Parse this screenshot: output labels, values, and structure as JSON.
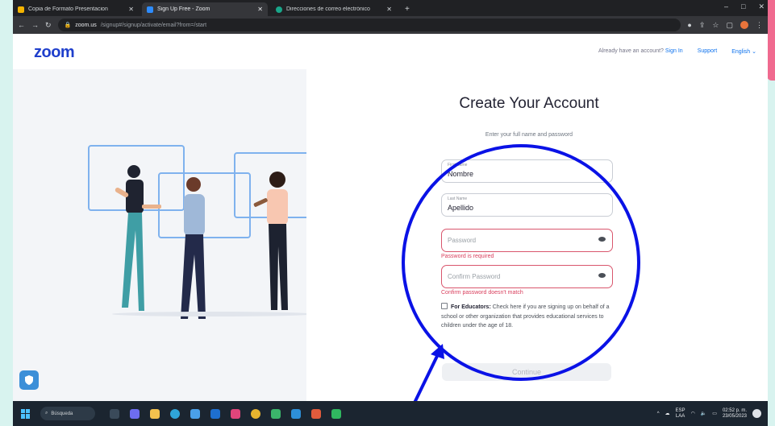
{
  "browser": {
    "tabs": [
      {
        "title": "Copia de Formato Presentacion",
        "favicon_color": "#f4b400",
        "active": false
      },
      {
        "title": "Sign Up Free - Zoom",
        "favicon_color": "#2d8cff",
        "active": true
      },
      {
        "title": "Direcciones de correo electrónico",
        "favicon_color": "#19a68a",
        "active": false
      }
    ],
    "url_domain": "zoom.us",
    "url_path": "/signup#/signup/activate/email?from=/start",
    "window_controls": [
      "–",
      "□",
      "✕"
    ]
  },
  "page": {
    "logo": "zoom",
    "nav": {
      "account_prompt": "Already have an account?",
      "sign_in": "Sign In",
      "support": "Support",
      "language": "English"
    },
    "heading": "Create Your Account",
    "subtext": "Enter your full name and password",
    "form": {
      "first_name": {
        "label": "First Name",
        "value": "Nombre"
      },
      "last_name": {
        "label": "Last Name",
        "value": "Apellido"
      },
      "password": {
        "placeholder": "Password",
        "error": "Password is required"
      },
      "confirm_password": {
        "placeholder": "Confirm Password",
        "error": "Confirm password doesn't match"
      },
      "educators": {
        "bold": "For Educators:",
        "text": "Check here if you are signing up on behalf of a school or other organization that provides educational services to children under the age of 18."
      },
      "continue_label": "Continue"
    }
  },
  "taskbar": {
    "search_label": "Búsqueda",
    "lang": "ESP",
    "region": "LAA",
    "time": "02:52 p. m.",
    "date": "23/05/2023"
  },
  "colors": {
    "zoom_blue": "#1f3fcc",
    "annotation_blue": "#0a12e6",
    "error_red": "#d9405e"
  }
}
